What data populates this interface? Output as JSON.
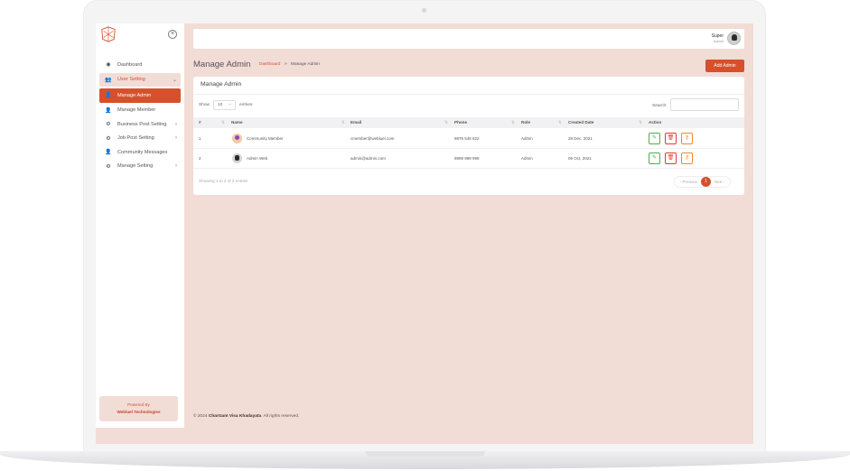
{
  "user": {
    "name": "Super",
    "role": "Admin"
  },
  "sidebar": {
    "items": [
      {
        "label": "Dashboard",
        "icon": "palette-icon"
      },
      {
        "label": "User Setting",
        "icon": "users-icon"
      },
      {
        "label": "Manage Admin",
        "icon": "user-icon"
      },
      {
        "label": "Manage Member",
        "icon": "user-icon"
      },
      {
        "label": "Business Post Setting",
        "icon": "gear-icon"
      },
      {
        "label": "Job Post Setting",
        "icon": "gear-icon"
      },
      {
        "label": "Community Messages",
        "icon": "user-icon"
      },
      {
        "label": "Manage Setting",
        "icon": "gear-icon"
      }
    ],
    "powered_by": "Powered By",
    "company": "Webluel Technologies"
  },
  "header": {
    "title": "Manage Admin",
    "breadcrumb_link": "Dashboard",
    "breadcrumb_sep": ">",
    "breadcrumb_current": "Manage Admin",
    "add_button": "Add Admin"
  },
  "card": {
    "title": "Manage Admin",
    "show_label": "Show",
    "show_value": "10",
    "entries_label": "entries",
    "search_label": "Search:"
  },
  "table": {
    "columns": [
      "#",
      "Name",
      "Email",
      "Phone",
      "Role",
      "Created Date",
      "Action"
    ],
    "rows": [
      {
        "num": "1",
        "name": "Community Member",
        "email": "cmember@webluel.com",
        "phone": "9876 546 622",
        "role": "Admin",
        "date": "28 Dec, 2021"
      },
      {
        "num": "2",
        "name": "Admin Web",
        "email": "admin@admin.com",
        "phone": "9999 999 999",
        "role": "Admin",
        "date": "06 Oct, 2021"
      }
    ]
  },
  "info": "Showing 1 to 2 of 2 entries",
  "pager": {
    "prev": "‹ Previous",
    "current": "1",
    "next": "Next ›"
  },
  "footer": {
    "prefix": "© 2024",
    "brand": "CharGam Visa Khadayata",
    "suffix": ". All rights reserved."
  },
  "colors": {
    "accent": "#d6502c",
    "bg": "#f2dcd6"
  }
}
